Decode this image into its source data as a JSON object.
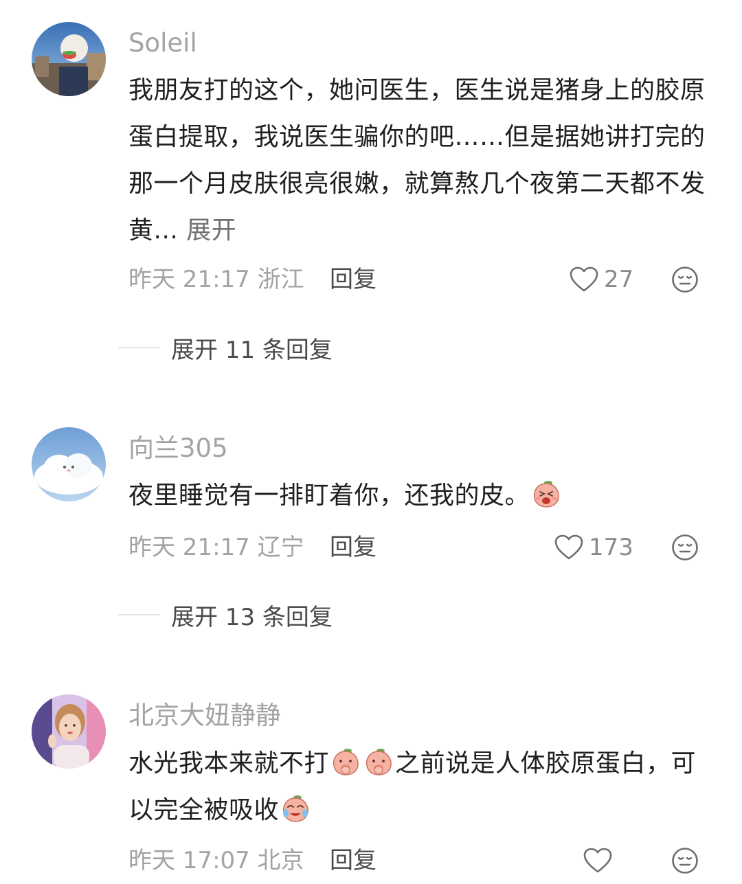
{
  "comments": [
    {
      "username": "Soleil",
      "text": "我朋友打的这个，她问医生，医生说是猪身上的胶原蛋白提取，我说医生骗你的吧……但是据她讲打完的那一个月皮肤很亮很嫩，就算熬几个夜第二天都不发黄...",
      "expand_label": "展开",
      "meta": "昨天 21:17 浙江",
      "reply_label": "回复",
      "likes": "27",
      "expand_replies": "展开 11 条回复"
    },
    {
      "username": "向兰305",
      "text": "夜里睡觉有一排盯着你，还我的皮。",
      "meta": "昨天 21:17 辽宁",
      "reply_label": "回复",
      "likes": "173",
      "expand_replies": "展开 13 条回复"
    },
    {
      "username": "北京大妞静静",
      "text_part1": "水光我本来就不打",
      "text_part2": "之前说是人体胶原蛋白，可以完全被吸收",
      "meta": "昨天 17:07 北京",
      "reply_label": "回复"
    }
  ],
  "icons": {
    "like": "heart-outline-icon",
    "dislike": "neutral-face-icon",
    "emoji": "peach-sticker-emoji"
  },
  "colors": {
    "username": "#a3a3a3",
    "text": "#1f1f1f",
    "meta": "#a3a3a3",
    "reply": "#4a4a4a",
    "divider": "#e3e3e3"
  }
}
